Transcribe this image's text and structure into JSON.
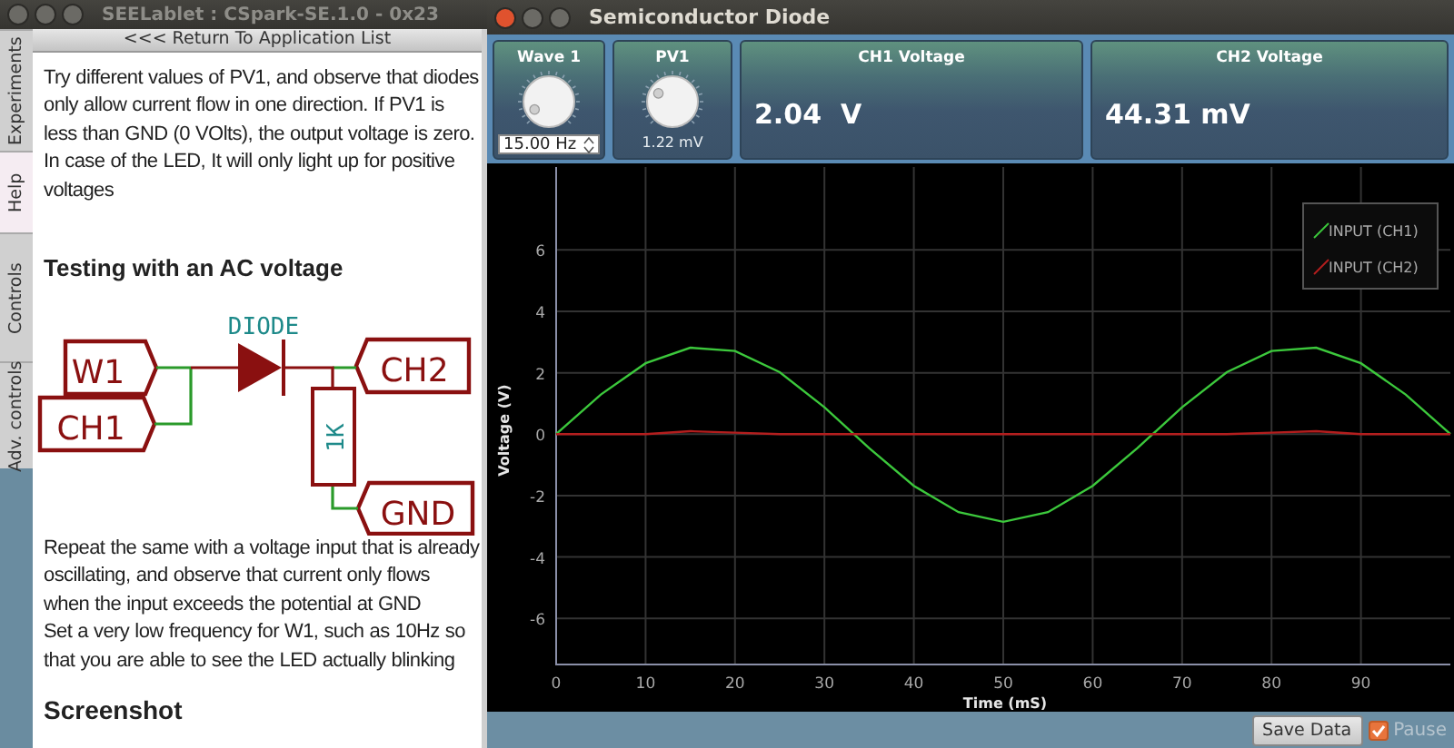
{
  "help_window": {
    "title": "SEELablet : CSpark-SE.1.0 - 0x23",
    "side_tabs": [
      {
        "label": "Experiments",
        "selected": false
      },
      {
        "label": "Help",
        "selected": true
      },
      {
        "label": "Controls",
        "selected": false
      },
      {
        "label": "Adv. controls",
        "selected": false
      }
    ],
    "return_link": "<<< Return To Application List",
    "paragraphs_top": [
      "Try different values of PV1, and observe that diodes only allow current flow in one direction. If PV1 is less than GND (0 VOlts), the output voltage is zero.",
      "In case of the LED, It will only light up for positive voltages"
    ],
    "heading_1": "Testing with an AC voltage",
    "circuit": {
      "diode_label": "DIODE",
      "resistor_label": "1K",
      "ports": [
        "W1",
        "CH1",
        "CH2",
        "GND"
      ]
    },
    "paragraphs_bottom": [
      "Repeat the same with a voltage input that is already oscillating, and observe that current only flows when the input exceeds the potential at GND",
      "Set a very low frequency for W1, such as 10Hz so that you are able to see the LED actually blinking"
    ],
    "heading_2": "Screenshot"
  },
  "experiment_window": {
    "title": "Semiconductor Diode",
    "wave1": {
      "title": "Wave 1",
      "value": "15.00 Hz"
    },
    "pv1": {
      "title": "PV1",
      "reading": "1.22 mV"
    },
    "readouts": [
      {
        "title": "CH1 Voltage",
        "reading": "2.04  V"
      },
      {
        "title": "CH2 Voltage",
        "reading": "44.31 mV"
      }
    ],
    "plot": {
      "chart_data": {
        "type": "line",
        "xlabel": "Time (mS)",
        "ylabel": "Voltage (V)",
        "x": [
          0,
          5,
          10,
          15,
          20,
          25,
          30,
          35,
          40,
          45,
          50,
          55,
          60,
          65,
          70,
          75,
          80,
          85,
          90,
          95,
          100
        ],
        "series": [
          {
            "name": "INPUT (CH1)",
            "color": "#3cc83c",
            "values": [
              0,
              1.29,
              2.31,
              2.82,
              2.71,
              2.02,
              0.88,
              -0.45,
              -1.68,
              -2.54,
              -2.85,
              -2.54,
              -1.68,
              -0.45,
              0.88,
              2.02,
              2.71,
              2.82,
              2.31,
              1.29,
              0
            ]
          },
          {
            "name": "INPUT (CH2)",
            "color": "#b41e1e",
            "values": [
              0,
              0,
              0,
              0.1,
              0.05,
              0,
              0,
              0,
              0,
              0,
              0,
              0,
              0,
              0,
              0,
              0,
              0.05,
              0.1,
              0,
              0,
              0
            ]
          }
        ],
        "xlim": [
          0,
          100
        ],
        "ylim": [
          -7.5,
          8.7
        ],
        "xticks": [
          0,
          10,
          20,
          30,
          40,
          50,
          60,
          70,
          80,
          90
        ],
        "yticks": [
          -6,
          -4,
          -2,
          0,
          2,
          4,
          6
        ],
        "grid": true,
        "legend": true
      }
    },
    "save_button": "Save Data",
    "pause": {
      "label": "Pause",
      "checked": true
    }
  }
}
